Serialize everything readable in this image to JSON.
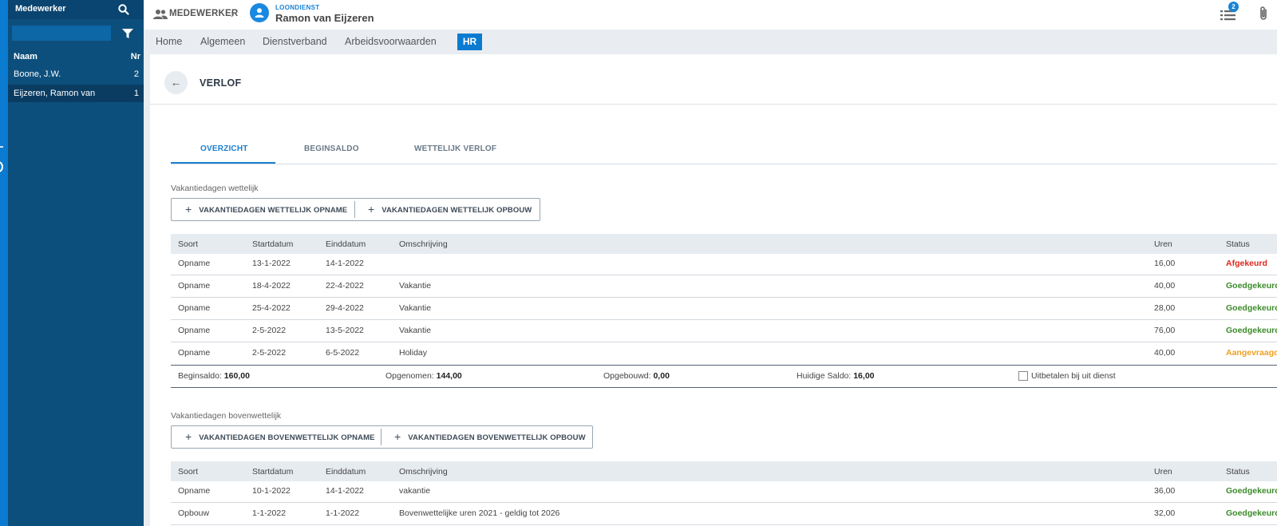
{
  "sidebar": {
    "title": "Medewerker",
    "columns": {
      "name": "Naam",
      "nr": "Nr"
    },
    "rows": [
      {
        "name": "Boone, J.W.",
        "nr": "2"
      },
      {
        "name": "Eijzeren, Ramon van",
        "nr": "1"
      }
    ]
  },
  "header": {
    "breadcrumb": "MEDEWERKER",
    "subtitle": "LOONDIENST",
    "employee_name": "Ramon van Eijzeren",
    "tasks_count": "2"
  },
  "nav": {
    "items": [
      "Home",
      "Algemeen",
      "Dienstverband",
      "Arbeidsvoorwaarden"
    ],
    "active": "HR"
  },
  "page": {
    "title": "VERLOF",
    "back_icon": "←"
  },
  "tabs": [
    "OVERZICHT",
    "BEGINSALDO",
    "WETTELIJK VERLOF"
  ],
  "section1": {
    "label": "Vakantiedagen wettelijk",
    "buttons": [
      "VAKANTIEDAGEN WETTELIJK OPNAME",
      "VAKANTIEDAGEN WETTELIJK OPBOUW"
    ],
    "columns": [
      "Soort",
      "Startdatum",
      "Einddatum",
      "Omschrijving",
      "Uren",
      "Status"
    ],
    "rows": [
      {
        "soort": "Opname",
        "start": "13-1-2022",
        "eind": "14-1-2022",
        "omschrijving": "",
        "uren": "16,00",
        "status": "Afgekeurd"
      },
      {
        "soort": "Opname",
        "start": "18-4-2022",
        "eind": "22-4-2022",
        "omschrijving": "Vakantie",
        "uren": "40,00",
        "status": "Goedgekeurd"
      },
      {
        "soort": "Opname",
        "start": "25-4-2022",
        "eind": "29-4-2022",
        "omschrijving": "Vakantie",
        "uren": "28,00",
        "status": "Goedgekeurd"
      },
      {
        "soort": "Opname",
        "start": "2-5-2022",
        "eind": "13-5-2022",
        "omschrijving": "Vakantie",
        "uren": "76,00",
        "status": "Goedgekeurd"
      },
      {
        "soort": "Opname",
        "start": "2-5-2022",
        "eind": "6-5-2022",
        "omschrijving": "Holiday",
        "uren": "40,00",
        "status": "Aangevraagd"
      }
    ],
    "totals": {
      "beginsaldo_label": "Beginsaldo:",
      "beginsaldo": "160,00",
      "opgenomen_label": "Opgenomen:",
      "opgenomen": "144,00",
      "opgebouwd_label": "Opgebouwd:",
      "opgebouwd": "0,00",
      "saldo_label": "Huidige Saldo:",
      "saldo": "16,00",
      "checkbox_label": "Uitbetalen bij uit dienst"
    }
  },
  "section2": {
    "label": "Vakantiedagen bovenwettelijk",
    "buttons": [
      "VAKANTIEDAGEN BOVENWETTELIJK OPNAME",
      "VAKANTIEDAGEN BOVENWETTELIJK OPBOUW"
    ],
    "columns": [
      "Soort",
      "Startdatum",
      "Einddatum",
      "Omschrijving",
      "Uren",
      "Status"
    ],
    "rows": [
      {
        "soort": "Opname",
        "start": "10-1-2022",
        "eind": "14-1-2022",
        "omschrijving": "vakantie",
        "uren": "36,00",
        "status": "Goedgekeurd"
      },
      {
        "soort": "Opbouw",
        "start": "1-1-2022",
        "eind": "1-1-2022",
        "omschrijving": "Bovenwettelijke uren 2021 - geldig tot 2026",
        "uren": "32,00",
        "status": "Goedgekeurd"
      }
    ]
  },
  "colors": {
    "accent": "#0a7bd0",
    "sidebar": "#0d4f7c",
    "rejected": "#e0261e",
    "approved": "#3c8b2b",
    "requested": "#f0a020"
  },
  "icons": {
    "plus": "+",
    "chevron": "›"
  }
}
